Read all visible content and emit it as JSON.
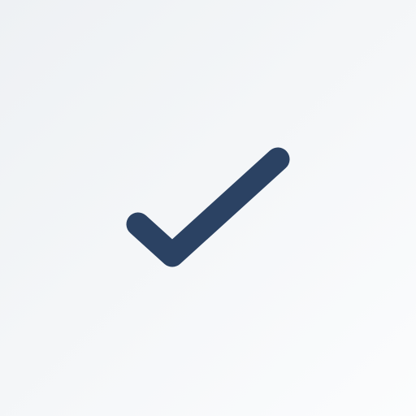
{
  "canvas": {
    "background_gradient": [
      "#eef1f4",
      "#fbfcfd"
    ]
  },
  "icon": {
    "name": "checkmark-icon",
    "color": "#2b4263"
  }
}
